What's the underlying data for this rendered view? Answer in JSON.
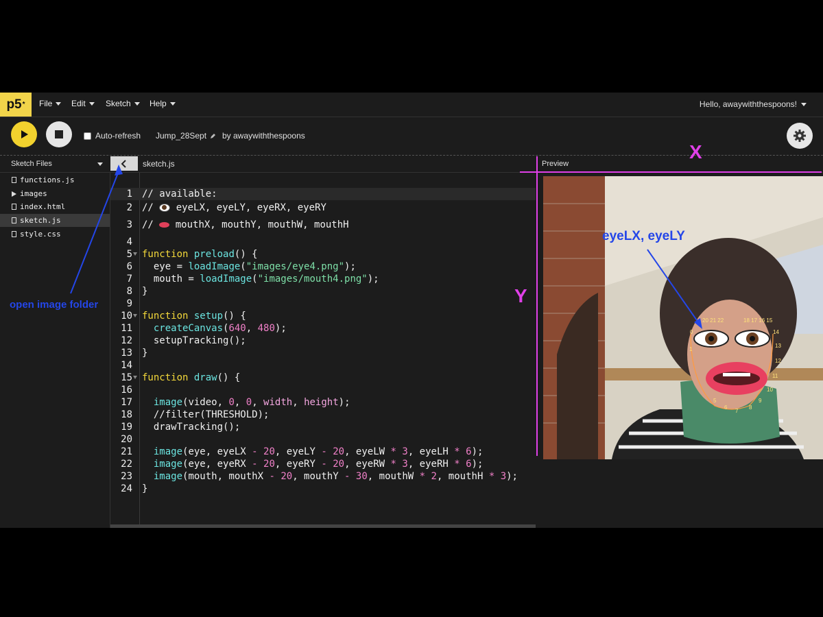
{
  "menubar": {
    "logo": "p5",
    "logo_mark": "*",
    "items": [
      "File",
      "Edit",
      "Sketch",
      "Help"
    ],
    "user_greeting": "Hello, awaywiththespoons!"
  },
  "toolbar": {
    "play_icon": "play-icon",
    "stop_icon": "stop-icon",
    "auto_refresh_label": "Auto-refresh",
    "auto_refresh_checked": false,
    "sketch_name": "Jump_28Sept",
    "byline": "by awaywiththespoons",
    "settings_icon": "gear-icon"
  },
  "sidebar": {
    "title": "Sketch Files",
    "files": [
      {
        "name": "functions.js",
        "type": "file"
      },
      {
        "name": "images",
        "type": "folder"
      },
      {
        "name": "index.html",
        "type": "file"
      },
      {
        "name": "sketch.js",
        "type": "file",
        "selected": true
      },
      {
        "name": "style.css",
        "type": "file"
      }
    ]
  },
  "editor": {
    "tab_name": "sketch.js",
    "collapse_icon": "chevron-left-icon",
    "line_numbers": [
      "1",
      "2",
      "3",
      "4",
      "5",
      "6",
      "7",
      "8",
      "9",
      "10",
      "11",
      "12",
      "13",
      "14",
      "15",
      "16",
      "17",
      "18",
      "19",
      "20",
      "21",
      "22",
      "23",
      "24"
    ],
    "lines": [
      "// available:",
      "//   eyeLX, eyeLY, eyeRX, eyeRY",
      "//   mouthX, mouthY, mouthW, mouthH",
      "",
      "function preload() {",
      "  eye = loadImage(\"images/eye4.png\");",
      "  mouth = loadImage(\"images/mouth4.png\");",
      "}",
      "",
      "function setup() {",
      "  createCanvas(640, 480);",
      "  setupTracking();",
      "}",
      "",
      "function draw() {",
      "",
      "  image(video, 0, 0, width, height);",
      "  //filter(THRESHOLD);",
      "  drawTracking();",
      "",
      "  image(eye, eyeLX - 20, eyeLY - 20, eyeLW * 3, eyeLH * 6);",
      "  image(eye, eyeRX - 20, eyeRY - 20, eyeRW * 3, eyeRH * 6);",
      "  image(mouth, mouthX - 20, mouthY - 30, mouthW * 2, mouthH * 3);",
      "}"
    ]
  },
  "preview": {
    "title": "Preview"
  },
  "annotations": {
    "open_folder": "open image folder",
    "eye_label": "eyeLX, eyeLY",
    "x_axis": "X",
    "y_axis": "Y"
  },
  "colors": {
    "accent_yellow": "#f2d22e",
    "annotation_blue": "#2446e8",
    "annotation_magenta": "#e040e8"
  }
}
